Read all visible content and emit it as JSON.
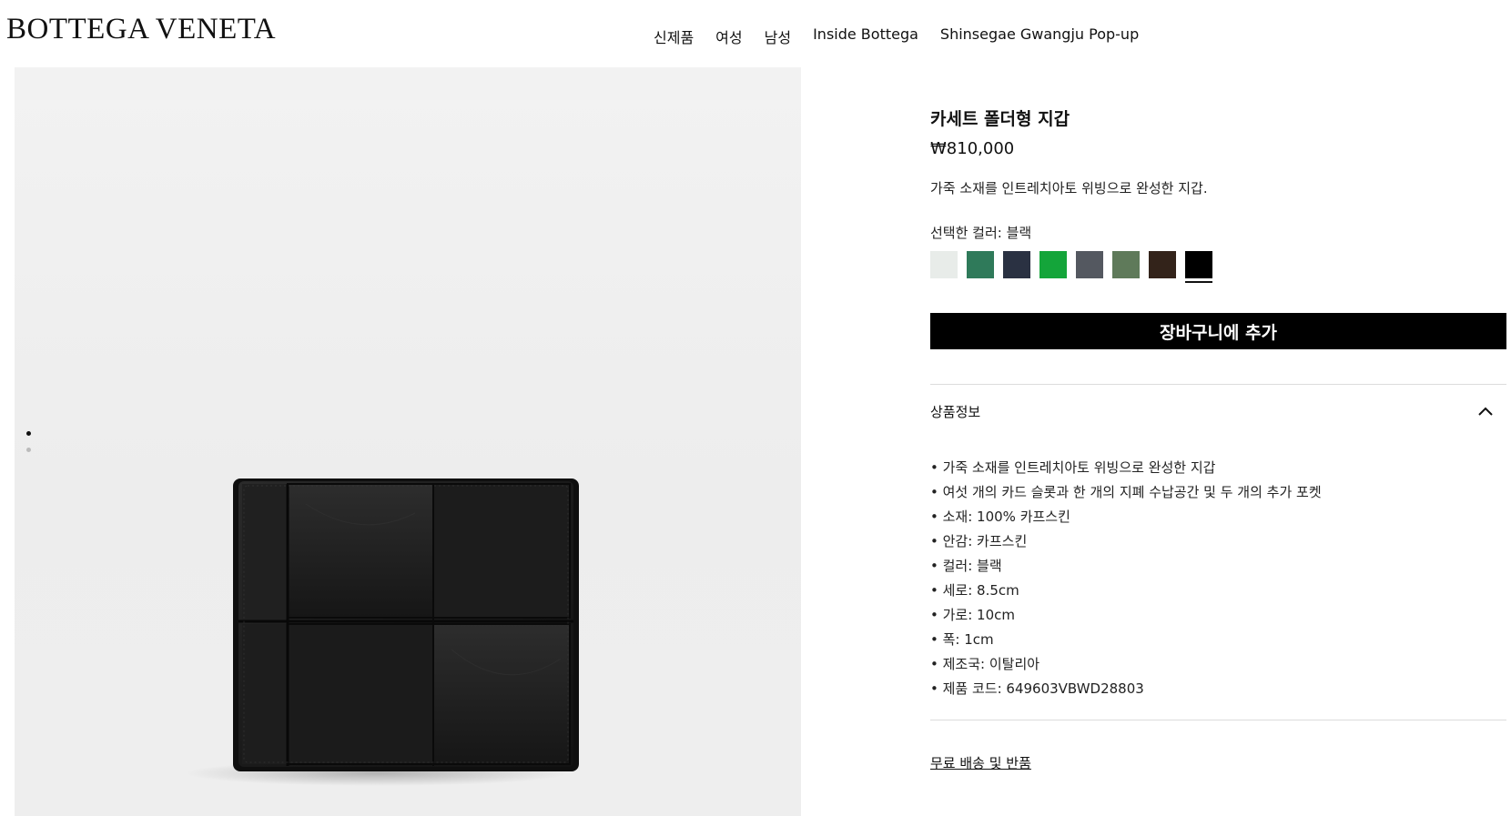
{
  "header": {
    "logo": "BOTTEGA VENETA",
    "nav": [
      "신제품",
      "여성",
      "남성",
      "Inside Bottega",
      "Shinsegae Gwangju Pop-up"
    ]
  },
  "gallery": {
    "image_icon": "wallet-image",
    "image_count": 2,
    "active_index": 1
  },
  "product": {
    "title": "카세트 폴더형 지갑",
    "price": "₩810,000",
    "description": "가죽 소재를 인트레치아토 위빙으로 완성한 지갑.",
    "color_label": "선택한 컬러: 블랙",
    "swatches": [
      {
        "color": "#e8ece9"
      },
      {
        "color": "#2f7a5a"
      },
      {
        "color": "#2a3142"
      },
      {
        "color": "#14a53a"
      },
      {
        "color": "#545860"
      },
      {
        "color": "#5f7a5a"
      },
      {
        "color": "#33231a"
      },
      {
        "color": "#000000",
        "selected": true
      }
    ],
    "add_to_cart": "장바구니에 추가",
    "details_heading": "상품정보",
    "details": [
      "가죽 소재를 인트레치아토 위빙으로 완성한 지갑",
      "여섯 개의 카드 슬롯과 한 개의 지폐 수납공간 및 두 개의 추가 포켓",
      "소재: 100% 카프스킨",
      "안감: 카프스킨",
      "컬러: 블랙",
      "세로: 8.5cm",
      "가로: 10cm",
      "폭: 1cm",
      "제조국: 이탈리아",
      "제품 코드: 649603VBWD28803"
    ],
    "shipping_link": "무료 배송 및 반품"
  }
}
